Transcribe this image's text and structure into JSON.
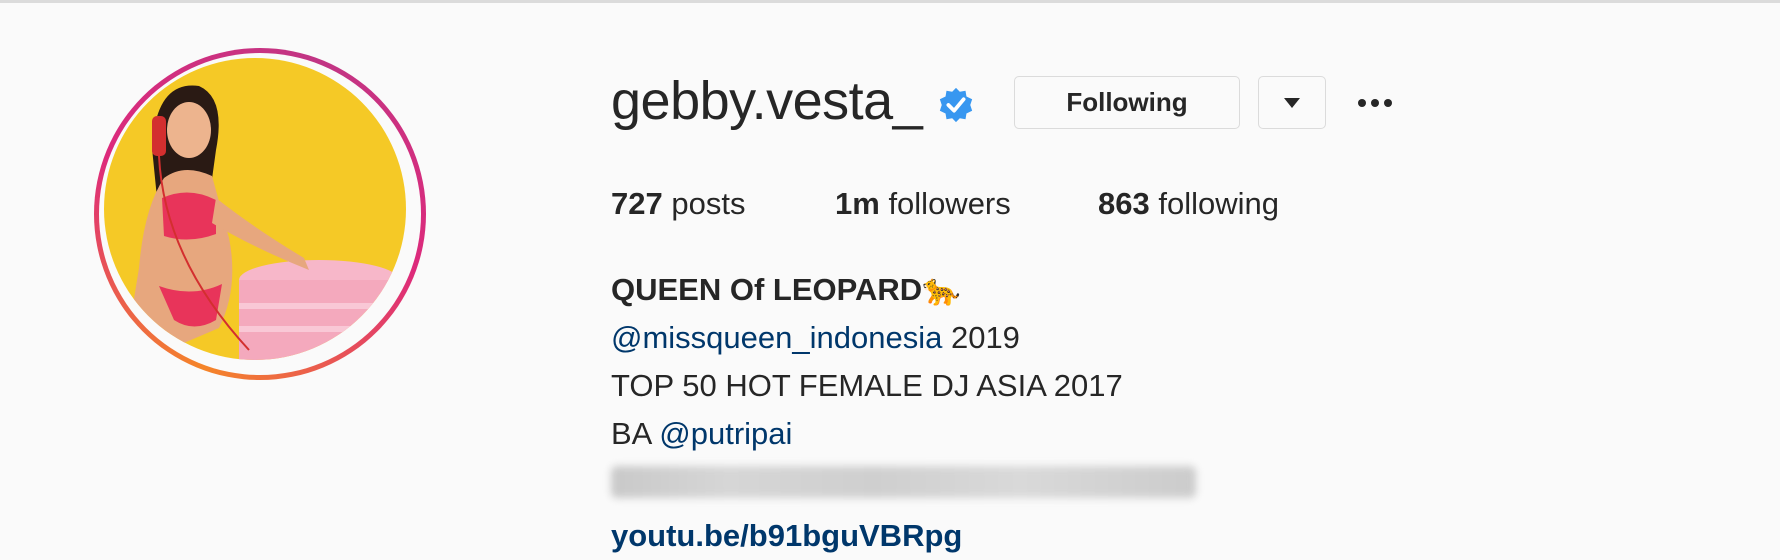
{
  "profile": {
    "username": "gebby.vesta_",
    "verified": true,
    "avatar_description": "profile photo",
    "ring_colors": [
      "#f58529",
      "#dd2a7b",
      "#c13584"
    ]
  },
  "actions": {
    "following_label": "Following",
    "dropdown_icon": "caret-down-icon",
    "more_icon": "ellipsis-icon"
  },
  "stats": {
    "posts_count": "727",
    "posts_label": "posts",
    "followers_count": "1m",
    "followers_label": "followers",
    "following_count": "863",
    "following_label": "following"
  },
  "bio": {
    "name": "QUEEN Of LEOPARD🐆",
    "line1_mention": "@missqueen_indonesia",
    "line1_text": " 2019",
    "line2": "TOP 50 HOT FEMALE DJ ASIA 2017",
    "line3_prefix": "BA ",
    "line3_mention": "@putripai",
    "website": "youtu.be/b91bguVBRpg"
  },
  "colors": {
    "link": "#00376b",
    "verified_badge": "#3897f0",
    "text": "#262626",
    "background": "#fafafa"
  }
}
